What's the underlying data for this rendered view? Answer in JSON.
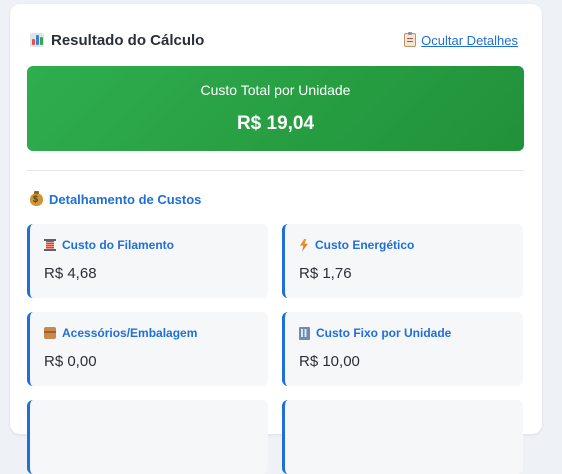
{
  "header": {
    "title": "Resultado do Cálculo",
    "title_icon": "bar-chart-icon",
    "toggle_label": "Ocultar Detalhes",
    "toggle_icon": "clipboard-icon"
  },
  "total": {
    "label": "Custo Total por Unidade",
    "value": "R$ 19,04",
    "color": "#28a745"
  },
  "breakdown": {
    "heading": "Detalhamento de Custos",
    "heading_icon": "money-bag-icon",
    "items": [
      {
        "label": "Custo do Filamento",
        "value": "R$ 4,68",
        "icon": "spool-icon"
      },
      {
        "label": "Custo Energético",
        "value": "R$ 1,76",
        "icon": "lightning-icon"
      },
      {
        "label": "Acessórios/Embalagem",
        "value": "R$ 0,00",
        "icon": "package-icon"
      },
      {
        "label": "Custo Fixo por Unidade",
        "value": "R$ 10,00",
        "icon": "building-icon"
      }
    ]
  },
  "colors": {
    "accent": "#1f6fd6",
    "total_bg": "#28a745"
  }
}
